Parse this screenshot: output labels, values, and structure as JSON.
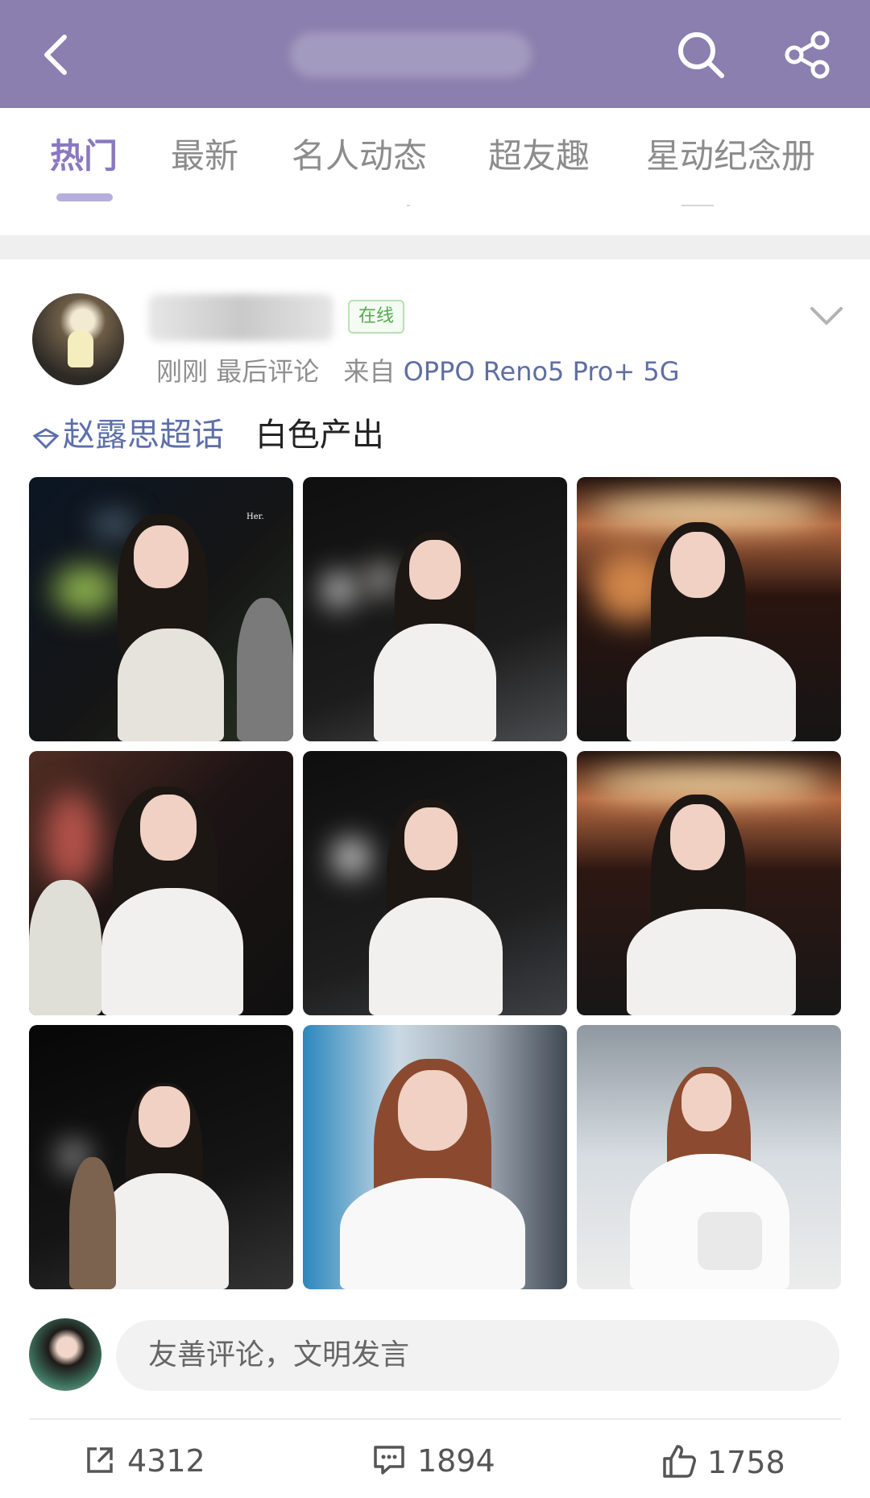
{
  "header": {
    "back_icon": "chevron-left-icon",
    "search_icon": "search-icon",
    "share_icon": "share-icon"
  },
  "tabs": [
    {
      "label": "热门",
      "active": true
    },
    {
      "label": "最新",
      "active": false
    },
    {
      "label": "名人动态",
      "active": false
    },
    {
      "label": "超友趣",
      "active": false
    },
    {
      "label": "星动纪念册",
      "active": false
    }
  ],
  "post": {
    "online_badge": "在线",
    "meta_time": "刚刚",
    "meta_last_comment": "最后评论",
    "meta_from": "来自",
    "meta_device": "OPPO Reno5 Pro+ 5G",
    "topic": "赵露思超话",
    "text": "白色产出",
    "photos": [
      {
        "scene": "night-white-tank"
      },
      {
        "scene": "night-white-cardigan-smile"
      },
      {
        "scene": "night-lights-side"
      },
      {
        "scene": "night-hair-touch"
      },
      {
        "scene": "night-white-cardigan-walk"
      },
      {
        "scene": "night-lights-close"
      },
      {
        "scene": "night-white-cardigan-laugh"
      },
      {
        "scene": "airport-white-tee-front"
      },
      {
        "scene": "airport-white-tee-bag"
      }
    ]
  },
  "comment": {
    "placeholder": "友善评论，文明发言"
  },
  "actions": {
    "repost_count": "4312",
    "comment_count": "1894",
    "like_count": "1758"
  },
  "colors": {
    "topbar": "#8a7fae",
    "tab_active": "#8a78c2",
    "topic_link": "#5d6faa"
  }
}
